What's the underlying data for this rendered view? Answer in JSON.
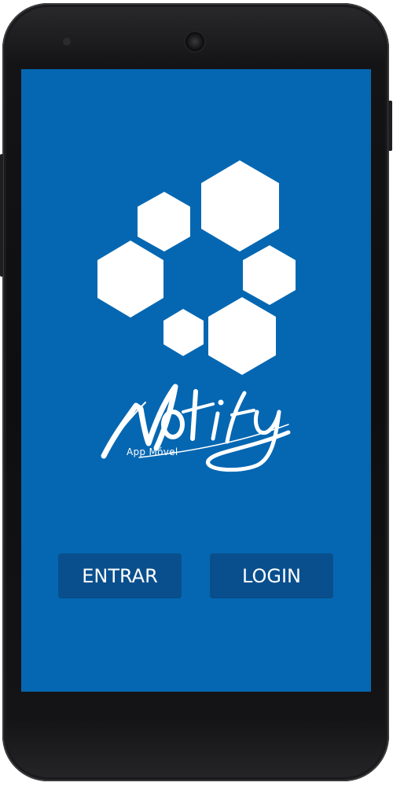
{
  "app": {
    "logo_text": "Notify",
    "logo_subtitle": "App Móvel",
    "logo_icon": "hexagon-cluster-icon"
  },
  "buttons": {
    "enter_label": "ENTRAR",
    "login_label": "LOGIN"
  },
  "colors": {
    "screen_background": "#0567b2",
    "button_background": "#0a4f8d",
    "phone_body": "#111113",
    "text": "#ffffff"
  }
}
